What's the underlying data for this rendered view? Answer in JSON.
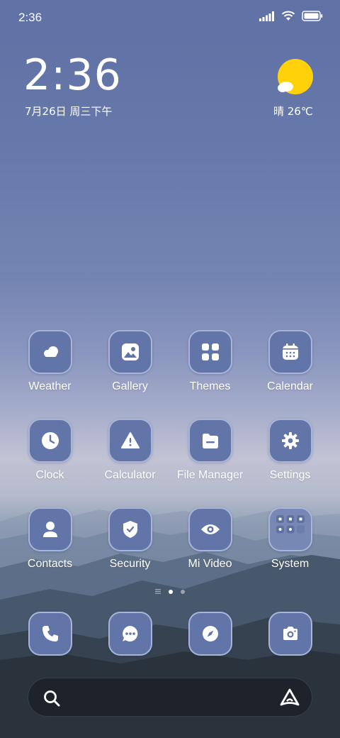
{
  "status_bar": {
    "time": "2:36",
    "icons": [
      "signal-icon",
      "wifi-icon",
      "battery-icon"
    ]
  },
  "clock_widget": {
    "time": "2:36",
    "date": "7月26日 周三下午"
  },
  "weather_widget": {
    "icon": "sunny-cloud-icon",
    "text": "晴 26℃"
  },
  "apps": [
    {
      "label": "Weather",
      "icon": "weather-cloud-icon"
    },
    {
      "label": "Gallery",
      "icon": "gallery-icon"
    },
    {
      "label": "Themes",
      "icon": "themes-grid-icon"
    },
    {
      "label": "Calendar",
      "icon": "calendar-icon"
    },
    {
      "label": "Clock",
      "icon": "clock-icon"
    },
    {
      "label": "Calculator",
      "icon": "calculator-icon"
    },
    {
      "label": "File Manager",
      "icon": "folder-icon"
    },
    {
      "label": "Settings",
      "icon": "gear-icon"
    },
    {
      "label": "Contacts",
      "icon": "person-icon"
    },
    {
      "label": "Security",
      "icon": "shield-icon"
    },
    {
      "label": "Mi Video",
      "icon": "eye-icon"
    },
    {
      "label": "System",
      "icon": "folder-system-icon"
    }
  ],
  "page_indicator": {
    "pages": 2,
    "active": 1
  },
  "dock": [
    {
      "icon": "phone-icon"
    },
    {
      "icon": "message-icon"
    },
    {
      "icon": "browser-compass-icon"
    },
    {
      "icon": "camera-icon"
    }
  ],
  "search_bar": {
    "left_icon": "search-icon",
    "right_icon": "assistant-icon"
  },
  "colors": {
    "icon_bg": "#6275a8",
    "icon_border": "#a9b5d8",
    "sun": "#ffd10a"
  }
}
